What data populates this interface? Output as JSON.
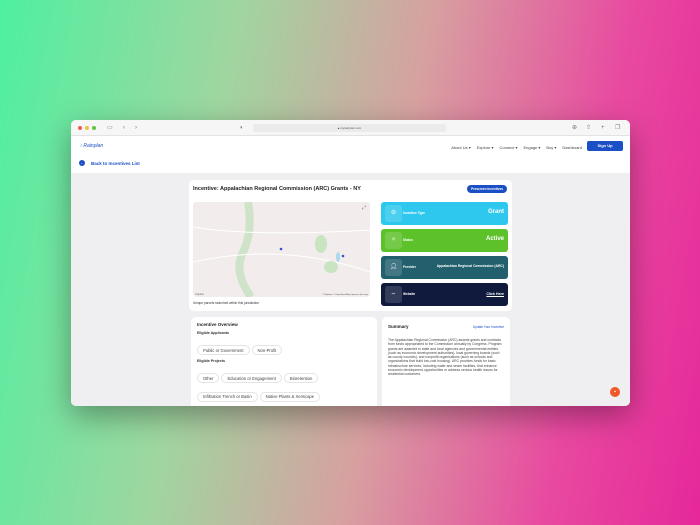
{
  "browser": {
    "url": "myrainplan.com"
  },
  "nav": {
    "logo": "Rainplan",
    "menu": [
      "About Us ▾",
      "Explore ▾",
      "Connect ▾",
      "Engage ▾",
      "Buy ▾",
      "Dashboard"
    ],
    "signup": "Sign Up",
    "back": "Back to Incentives List"
  },
  "incentive": {
    "title": "Incentive: Appalachian Regional Commission (ARC) Grants - NY",
    "prescreen": "Prescreen Incentives",
    "map_caption": "Unique parcels searched within this jurisdiction",
    "map_attrib": "© Mapbox © OpenStreetMap Improve this map",
    "map_logo": "mapbox",
    "tiles": [
      {
        "label": "Incentive Type",
        "value": "Grant",
        "color": "#2ec8ee"
      },
      {
        "label": "Status",
        "value": "Active",
        "color": "#5dc22a"
      },
      {
        "label": "Provider",
        "value": "Appalachian Regional Commission (ARC)",
        "color": "#22606e"
      },
      {
        "label": "Website",
        "value": "Click Here",
        "color": "#101a3c"
      }
    ]
  },
  "overview": {
    "title": "Incentive Overview",
    "applicants_label": "Eligible Applicants",
    "applicants": [
      "Public or Government",
      "Non-Profit"
    ],
    "projects_label": "Eligible Projects",
    "projects": [
      "Other",
      "Education or Engagement",
      "Bioretention",
      "Infiltration Trench or Basin",
      "Native Plants & Xeriscape"
    ]
  },
  "summary": {
    "title": "Summary",
    "update": "Update Your Incentive",
    "text": "The Appalachian Regional Commission (ARC) awards grants and contracts from funds appropriated to the Commission annually by Congress. Program grants are awarded to state and local agencies and governmental entities (such as economic development authorities), local governing boards (such as county councils), and nonprofit organizations (such as schools and organizations that build low-cost housing). ARC provides funds for basic infrastructure services, including water and sewer facilities, that enhance economic development opportunities or address serious health issues for residential customers."
  }
}
